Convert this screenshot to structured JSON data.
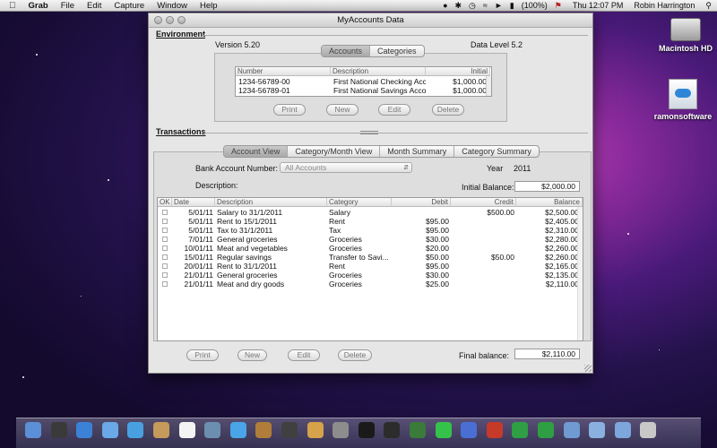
{
  "menubar": {
    "app_name": "Grab",
    "items": [
      "File",
      "Edit",
      "Capture",
      "Window",
      "Help"
    ],
    "battery": "(100%)",
    "clock": "Thu 12:07 PM",
    "user": "Robin Harrington"
  },
  "desktop": {
    "icons": [
      {
        "label": "Macintosh HD",
        "icon": "hard-drive-icon"
      },
      {
        "label": "ramonsoftware",
        "icon": "cloud-document-icon"
      }
    ]
  },
  "window": {
    "title": "MyAccounts Data",
    "environment": {
      "section_label": "Environment",
      "version": "Version 5.20",
      "data_level": "Data Level 5.2",
      "tabs": [
        "Accounts",
        "Categories"
      ],
      "selected_tab": "Accounts",
      "columns": [
        "Number",
        "Description",
        "Initial"
      ],
      "rows": [
        [
          "1234-56789-00",
          "First National Checking Acco...",
          "$1,000.00"
        ],
        [
          "1234-56789-01",
          "First National Savings Account",
          "$1,000.00"
        ]
      ],
      "buttons": [
        "Print",
        "New",
        "Edit",
        "Delete"
      ]
    },
    "transactions": {
      "section_label": "Transactions",
      "tabs": [
        "Account View",
        "Category/Month View",
        "Month Summary",
        "Category Summary"
      ],
      "selected_tab": "Account View",
      "bank_account_label": "Bank Account Number:",
      "bank_account_value": "All Accounts",
      "year_label": "Year",
      "year_value": "2011",
      "description_label": "Description:",
      "initial_balance_label": "Initial Balance:",
      "initial_balance_value": "$2,000.00",
      "columns": [
        "OK",
        "Date",
        "Description",
        "Category",
        "Debit",
        "Credit",
        "Balance"
      ],
      "rows": [
        [
          "",
          "5/01/11",
          "Salary to 31/1/2011",
          "Salary",
          "",
          "$500.00",
          "$2,500.00"
        ],
        [
          "",
          "5/01/11",
          "Rent to 15/1/2011",
          "Rent",
          "$95.00",
          "",
          "$2,405.00"
        ],
        [
          "",
          "5/01/11",
          "Tax to 31/1/2011",
          "Tax",
          "$95.00",
          "",
          "$2,310.00"
        ],
        [
          "",
          "7/01/11",
          "General groceries",
          "Groceries",
          "$30.00",
          "",
          "$2,280.00"
        ],
        [
          "",
          "10/01/11",
          "Meat and vegetables",
          "Groceries",
          "$20.00",
          "",
          "$2,260.00"
        ],
        [
          "",
          "15/01/11",
          "Regular savings",
          "Transfer to Savi...",
          "$50.00",
          "$50.00",
          "$2,260.00"
        ],
        [
          "",
          "20/01/11",
          "Rent to 31/1/2011",
          "Rent",
          "$95.00",
          "",
          "$2,165.00"
        ],
        [
          "",
          "21/01/11",
          "General groceries",
          "Groceries",
          "$30.00",
          "",
          "$2,135.00"
        ],
        [
          "",
          "21/01/11",
          "Meat and dry goods",
          "Groceries",
          "$25.00",
          "",
          "$2,110.00"
        ]
      ],
      "buttons": [
        "Print",
        "New",
        "Edit",
        "Delete"
      ],
      "final_balance_label": "Final balance:",
      "final_balance_value": "$2,110.00"
    }
  },
  "dock": {
    "icons": [
      "finder-icon",
      "dashboard-icon",
      "safari-icon",
      "mail-icon",
      "ichat-icon",
      "address-book-icon",
      "calendar-icon",
      "preview-icon",
      "itunes-icon",
      "iphoto-icon",
      "imovie-icon",
      "garageband-icon",
      "system-preferences-icon",
      "terminal-icon",
      "activity-monitor-icon",
      "time-machine-icon",
      "app-icon",
      "xcode-icon",
      "game-icon",
      "maps-icon",
      "spreadsheet-icon",
      "folder-icon",
      "documents-icon",
      "downloads-icon",
      "trash-icon"
    ],
    "colors": [
      "#5b8fd8",
      "#3a3a3a",
      "#3b82d6",
      "#6aa8e8",
      "#49a0e0",
      "#c59a5a",
      "#f4f4f4",
      "#6c8fb0",
      "#4aa4e8",
      "#b07d3a",
      "#404040",
      "#d6a24a",
      "#8d8d8d",
      "#1a1a1a",
      "#2c2c2c",
      "#3a7a3a",
      "#35c24a",
      "#4a6fd4",
      "#c63a2a",
      "#2f9e44",
      "#2ea043",
      "#6f9ad2",
      "#8ab0e0",
      "#7da6dc",
      "#c8c8c8"
    ]
  }
}
